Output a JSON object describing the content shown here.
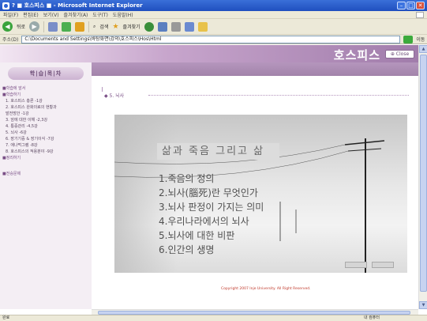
{
  "window": {
    "title": "? ■ 호스피스 ■ - Microsoft Internet Explorer",
    "min": "–",
    "max": "□",
    "close": "✕"
  },
  "menu": [
    "파일(F)",
    "편집(E)",
    "보기(V)",
    "즐겨찾기(A)",
    "도구(T)",
    "도움말(H)"
  ],
  "toolbar": {
    "back": "뒤로",
    "search": "검색",
    "favorites": "즐겨찾기"
  },
  "address": {
    "label": "주소(D)",
    "value": "C:\\Documents and Settings\\바탕화면\\강의\\호스피스\\Hos\\Html"
  },
  "go": "이동",
  "banner": {
    "brand": "호스피스",
    "close": "⊕ Close"
  },
  "sidebar": {
    "heading": "학|습|목|차",
    "items": [
      {
        "label": "■학습에 앞서",
        "type": "cat"
      },
      {
        "label": "■학습하기",
        "type": "cat"
      },
      {
        "label": "1. 호스피스 총론 -1강",
        "type": "sub"
      },
      {
        "label": "2. 호스피스 완화의료의 현황과",
        "type": "sub"
      },
      {
        "label": "   발전방안 -1강",
        "type": "sub"
      },
      {
        "label": "3. 암에 대한 이해 -2,3강",
        "type": "sub"
      },
      {
        "label": "4. 통증관리 -4,5강",
        "type": "sub"
      },
      {
        "label": "5. 뇌사 -6강",
        "type": "sub"
      },
      {
        "label": "6. 장기기증 & 장기이식 -7강",
        "type": "sub"
      },
      {
        "label": "7. 애나먹그램 -8강",
        "type": "sub"
      },
      {
        "label": "8. 호스피스의 적용분야 -9강",
        "type": "sub"
      },
      {
        "label": "■정리하기",
        "type": "cat"
      },
      {
        "label": "■전승문제",
        "type": "cat gap"
      }
    ]
  },
  "content": {
    "section_title": "◆ 5. 뇌사",
    "slide": {
      "title": "삶과 죽음 그리고 삶",
      "items": [
        "1.죽음의 정의",
        "2.뇌사(腦死)란 무엇인가",
        "3.뇌사 판정이 가지는 의미",
        "4.우리나라에서의 뇌사",
        "5.뇌사에 대한 비판",
        "6.인간의 생명"
      ]
    },
    "copyright": "Copyright 2007 Inje University. All Right Reserved."
  },
  "status": {
    "left": "완료",
    "zone": "내 컴퓨터"
  }
}
